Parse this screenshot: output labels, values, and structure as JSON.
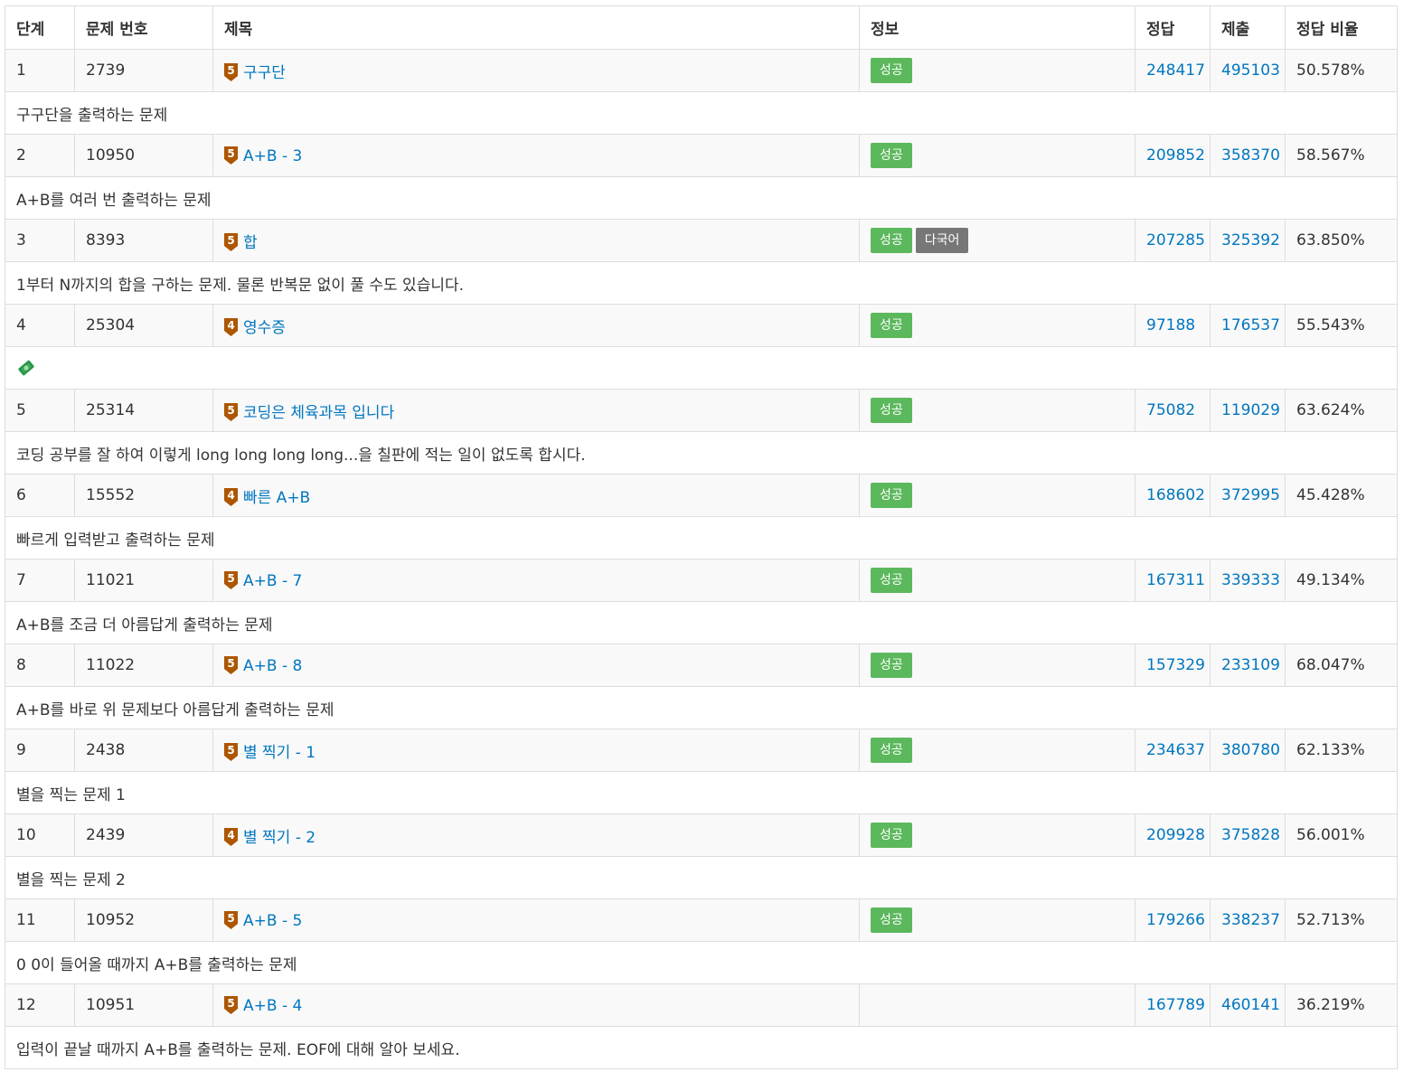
{
  "headers": [
    "단계",
    "문제 번호",
    "제목",
    "정보",
    "정답",
    "제출",
    "정답 비율"
  ],
  "colors": {
    "link": "#0076c0",
    "success_badge": "#5cb85c",
    "multilang_badge": "#777777",
    "bronze_tier": "#ad5600"
  },
  "rows": [
    {
      "step": "1",
      "problem_id": "2739",
      "tier": "5",
      "title": "구구단",
      "info": [
        "성공"
      ],
      "accepted": "248417",
      "submissions": "495103",
      "ratio": "50.578%",
      "description": "구구단을 출력하는 문제"
    },
    {
      "step": "2",
      "problem_id": "10950",
      "tier": "5",
      "title": "A+B - 3",
      "info": [
        "성공"
      ],
      "accepted": "209852",
      "submissions": "358370",
      "ratio": "58.567%",
      "description": "A+B를 여러 번 출력하는 문제"
    },
    {
      "step": "3",
      "problem_id": "8393",
      "tier": "5",
      "title": "합",
      "info": [
        "성공",
        "다국어"
      ],
      "accepted": "207285",
      "submissions": "325392",
      "ratio": "63.850%",
      "description": "1부터 N까지의 합을 구하는 문제. 물론 반복문 없이 풀 수도 있습니다."
    },
    {
      "step": "4",
      "problem_id": "25304",
      "tier": "4",
      "title": "영수증",
      "info": [
        "성공"
      ],
      "accepted": "97188",
      "submissions": "176537",
      "ratio": "55.543%",
      "description": "",
      "description_icon": "money-with-wings-icon"
    },
    {
      "step": "5",
      "problem_id": "25314",
      "tier": "5",
      "title": "코딩은 체육과목 입니다",
      "info": [
        "성공"
      ],
      "accepted": "75082",
      "submissions": "119029",
      "ratio": "63.624%",
      "description": "코딩 공부를 잘 하여 이렇게 long long long long...을 칠판에 적는 일이 없도록 합시다."
    },
    {
      "step": "6",
      "problem_id": "15552",
      "tier": "4",
      "title": "빠른 A+B",
      "info": [
        "성공"
      ],
      "accepted": "168602",
      "submissions": "372995",
      "ratio": "45.428%",
      "description": "빠르게 입력받고 출력하는 문제"
    },
    {
      "step": "7",
      "problem_id": "11021",
      "tier": "5",
      "title": "A+B - 7",
      "info": [
        "성공"
      ],
      "accepted": "167311",
      "submissions": "339333",
      "ratio": "49.134%",
      "description": "A+B를 조금 더 아름답게 출력하는 문제"
    },
    {
      "step": "8",
      "problem_id": "11022",
      "tier": "5",
      "title": "A+B - 8",
      "info": [
        "성공"
      ],
      "accepted": "157329",
      "submissions": "233109",
      "ratio": "68.047%",
      "description": "A+B를 바로 위 문제보다 아름답게 출력하는 문제"
    },
    {
      "step": "9",
      "problem_id": "2438",
      "tier": "5",
      "title": "별 찍기 - 1",
      "info": [
        "성공"
      ],
      "accepted": "234637",
      "submissions": "380780",
      "ratio": "62.133%",
      "description": "별을 찍는 문제 1"
    },
    {
      "step": "10",
      "problem_id": "2439",
      "tier": "4",
      "title": "별 찍기 - 2",
      "info": [
        "성공"
      ],
      "accepted": "209928",
      "submissions": "375828",
      "ratio": "56.001%",
      "description": "별을 찍는 문제 2"
    },
    {
      "step": "11",
      "problem_id": "10952",
      "tier": "5",
      "title": "A+B - 5",
      "info": [
        "성공"
      ],
      "accepted": "179266",
      "submissions": "338237",
      "ratio": "52.713%",
      "description": "0 0이 들어올 때까지 A+B를 출력하는 문제"
    },
    {
      "step": "12",
      "problem_id": "10951",
      "tier": "5",
      "title": "A+B - 4",
      "info": [],
      "accepted": "167789",
      "submissions": "460141",
      "ratio": "36.219%",
      "description": "입력이 끝날 때까지 A+B를 출력하는 문제. EOF에 대해 알아 보세요."
    }
  ]
}
